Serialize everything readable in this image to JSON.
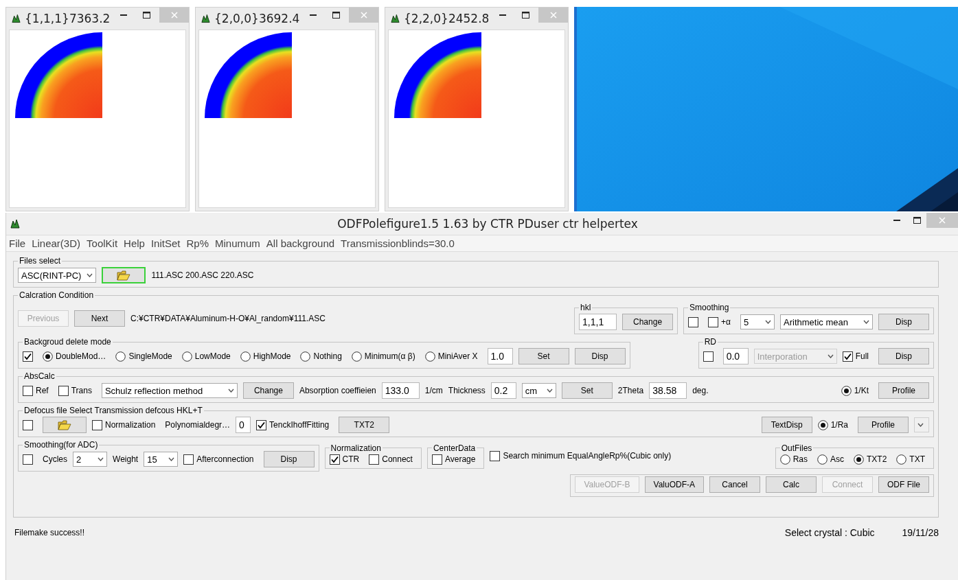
{
  "child_windows": [
    {
      "title": "{1,1,1}7363.2"
    },
    {
      "title": "{2,0,0}3692.4"
    },
    {
      "title": "{2,2,0}2452.8"
    }
  ],
  "main_window": {
    "title": "ODFPolefigure1.5 1.63 by CTR PDuser ctr helpertex"
  },
  "menu": [
    {
      "label": "File"
    },
    {
      "label": "Linear(3D)"
    },
    {
      "label": "ToolKit"
    },
    {
      "label": "Help"
    },
    {
      "label": "InitSet"
    },
    {
      "label": "Rp%"
    },
    {
      "label": "Minumum"
    },
    {
      "label": "All background"
    },
    {
      "label": "Transmissionblinds=30.0"
    }
  ],
  "files_select": {
    "legend": "Files select",
    "items": [
      {
        "kind": "select",
        "value": "ASC(RINT-PC)",
        "disabled": false
      },
      {
        "kind": "folder-button",
        "focused": true
      },
      {
        "kind": "text",
        "text": "111.ASC 200.ASC 220.ASC"
      }
    ]
  },
  "calc_condition": {
    "legend": "Calcration Condition",
    "lines": [
      {
        "items": [
          {
            "kind": "button",
            "label": "Previous",
            "disabled": true
          },
          {
            "kind": "button",
            "label": "Next",
            "disabled": false
          },
          {
            "kind": "text",
            "text": "C:¥CTR¥DATA¥Aluminum-H-O¥Al_random¥111.ASC"
          }
        ],
        "right_items": [
          {
            "kind": "group",
            "legend": "hkl",
            "items": [
              {
                "kind": "input",
                "value": "1,1,1"
              },
              {
                "kind": "button",
                "label": "Change",
                "disabled": false
              }
            ]
          },
          {
            "kind": "group",
            "legend": "Smoothing",
            "items": [
              {
                "kind": "checkbox",
                "checked": false
              },
              {
                "kind": "checkbox",
                "label": "+α",
                "checked": false
              },
              {
                "kind": "select",
                "value": "5",
                "disabled": false
              },
              {
                "kind": "select",
                "value": "Arithmetic mean",
                "disabled": false
              },
              {
                "kind": "button",
                "label": "Disp",
                "disabled": false
              }
            ]
          }
        ]
      },
      {
        "items": [
          {
            "kind": "group",
            "legend": "Backgroud delete mode",
            "items": [
              {
                "kind": "checkbox",
                "checked": true
              },
              {
                "kind": "radio",
                "label": "DoubleMod…",
                "selected": true
              },
              {
                "kind": "radio",
                "label": "SingleMode",
                "selected": false
              },
              {
                "kind": "radio",
                "label": "LowMode",
                "selected": false
              },
              {
                "kind": "radio",
                "label": "HighMode",
                "selected": false
              },
              {
                "kind": "radio",
                "label": "Nothing",
                "selected": false
              },
              {
                "kind": "radio",
                "label": "Minimum(α β)",
                "selected": false
              },
              {
                "kind": "radio",
                "label": "MiniAver X",
                "selected": false
              },
              {
                "kind": "input",
                "value": "1.0"
              },
              {
                "kind": "button",
                "label": "Set",
                "disabled": false
              },
              {
                "kind": "button",
                "label": "Disp",
                "disabled": false
              }
            ]
          }
        ],
        "right_items": [
          {
            "kind": "group",
            "legend": "RD",
            "items": [
              {
                "kind": "checkbox",
                "checked": false
              },
              {
                "kind": "input",
                "value": "0.0"
              },
              {
                "kind": "select",
                "value": "Interporation",
                "disabled": true
              }
            ],
            "right_items": [
              {
                "kind": "checkbox",
                "label": "Full",
                "checked": true
              },
              {
                "kind": "button",
                "label": "Disp",
                "disabled": false
              }
            ]
          }
        ]
      },
      {
        "items": [
          {
            "kind": "group",
            "legend": "AbsCalc",
            "items": [
              {
                "kind": "checkbox",
                "label": "Ref",
                "checked": false
              },
              {
                "kind": "checkbox",
                "label": "Trans",
                "checked": false
              },
              {
                "kind": "select",
                "value": "Schulz reflection method",
                "disabled": false
              },
              {
                "kind": "button",
                "label": "Change",
                "disabled": false
              },
              {
                "kind": "text",
                "text": "Absorption coeffieien"
              },
              {
                "kind": "input",
                "value": "133.0"
              },
              {
                "kind": "text",
                "text": "1/cm"
              },
              {
                "kind": "text",
                "text": "Thickness"
              },
              {
                "kind": "input",
                "value": "0.2"
              },
              {
                "kind": "select",
                "value": "cm",
                "disabled": false
              },
              {
                "kind": "button",
                "label": "Set",
                "disabled": false
              },
              {
                "kind": "text",
                "text": "2Theta"
              },
              {
                "kind": "input",
                "value": "38.58"
              },
              {
                "kind": "text",
                "text": "deg."
              }
            ],
            "right_items": [
              {
                "kind": "radio",
                "label": "1/Kt",
                "selected": true
              },
              {
                "kind": "button",
                "label": "Profile",
                "disabled": false
              }
            ]
          }
        ]
      },
      {
        "items": [
          {
            "kind": "group",
            "legend": "Defocus file Select Transmission defcous HKL+T",
            "items": [
              {
                "kind": "checkbox",
                "checked": false
              },
              {
                "kind": "folder-button",
                "focused": false
              },
              {
                "kind": "checkbox",
                "label": "Normalization",
                "checked": false
              },
              {
                "kind": "text",
                "text": "Polynomialdegr…"
              },
              {
                "kind": "input",
                "value": "0"
              },
              {
                "kind": "checkbox",
                "label": "TenckIhoffFitting",
                "checked": true
              },
              {
                "kind": "button",
                "label": "TXT2",
                "disabled": false
              }
            ],
            "right_items": [
              {
                "kind": "button",
                "label": "TextDisp",
                "disabled": false
              },
              {
                "kind": "radio",
                "label": "1/Ra",
                "selected": true
              },
              {
                "kind": "button",
                "label": "Profile",
                "disabled": false
              },
              {
                "kind": "select",
                "disabled": true
              }
            ]
          }
        ]
      },
      {
        "items": [
          {
            "kind": "group",
            "legend": "Smoothing(for ADC)",
            "items": [
              {
                "kind": "checkbox",
                "checked": false
              },
              {
                "kind": "text",
                "text": "Cycles"
              },
              {
                "kind": "select",
                "value": "2",
                "disabled": false
              },
              {
                "kind": "text",
                "text": "Weight"
              },
              {
                "kind": "select",
                "value": "15",
                "disabled": false
              },
              {
                "kind": "checkbox",
                "label": "Afterconnection",
                "checked": false
              },
              {
                "kind": "button",
                "label": "Disp",
                "disabled": false
              }
            ]
          },
          {
            "kind": "group",
            "legend": "Normalization",
            "items": [
              {
                "kind": "checkbox",
                "label": "CTR",
                "checked": true
              },
              {
                "kind": "checkbox",
                "label": "Connect",
                "checked": false
              }
            ]
          },
          {
            "kind": "group",
            "legend": "CenterData",
            "items": [
              {
                "kind": "checkbox",
                "label": "Average",
                "checked": false
              }
            ]
          },
          {
            "kind": "checkbox",
            "label": "Search minimum EqualAngleRp%(Cubic only)",
            "checked": false
          }
        ],
        "right_items": [
          {
            "kind": "group",
            "legend": "OutFiles",
            "items": [
              {
                "kind": "radio",
                "label": "Ras",
                "selected": false
              },
              {
                "kind": "radio",
                "label": "Asc",
                "selected": false
              },
              {
                "kind": "radio",
                "label": "TXT2",
                "selected": true
              },
              {
                "kind": "radio",
                "label": "TXT",
                "selected": false
              }
            ]
          }
        ]
      },
      {
        "right_items": [
          {
            "kind": "group",
            "items": [
              {
                "kind": "button",
                "label": "ValueODF-B",
                "disabled": true
              },
              {
                "kind": "button",
                "label": "ValuODF-A",
                "disabled": false
              },
              {
                "kind": "button",
                "label": "Cancel",
                "disabled": false
              },
              {
                "kind": "button",
                "label": "Calc",
                "disabled": false
              },
              {
                "kind": "button",
                "label": "Connect",
                "disabled": true
              },
              {
                "kind": "button",
                "label": "ODF File",
                "disabled": false
              }
            ]
          }
        ]
      }
    ]
  },
  "status_bar": {
    "message": "Filemake success!!",
    "crystal": "Select crystal : Cubic",
    "date": "19/11/28"
  }
}
